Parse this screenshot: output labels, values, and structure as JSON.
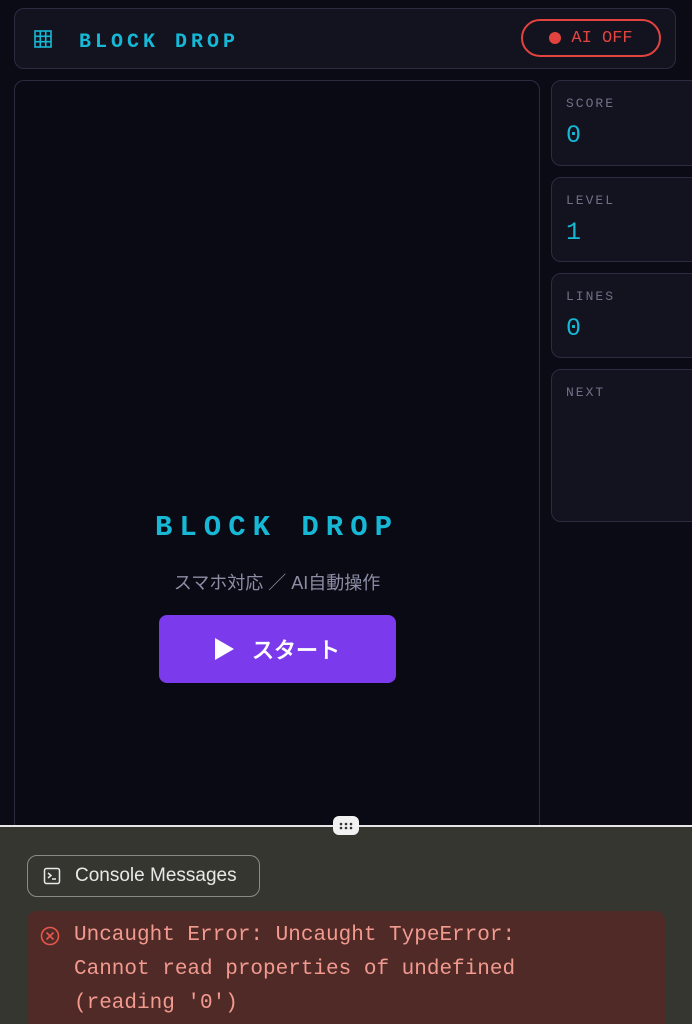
{
  "header": {
    "title": "BLOCK DROP",
    "grid_icon": "grid-icon",
    "ai_toggle_label": "AI OFF",
    "ai_status_color": "#e3433f"
  },
  "board": {
    "overlay_title": "BLOCK DROP",
    "overlay_subtitle": "スマホ対応 ／ AI自動操作",
    "start_label": "スタート",
    "start_color": "#7c3aed"
  },
  "stats": {
    "score_label": "SCORE",
    "score_value": "0",
    "level_label": "LEVEL",
    "level_value": "1",
    "lines_label": "LINES",
    "lines_value": "0",
    "next_label": "NEXT"
  },
  "devtools": {
    "tab_label": "Console Messages",
    "error_message": "Uncaught Error: Uncaught TypeError:\nCannot read properties of undefined\n(reading '0')"
  },
  "colors": {
    "accent": "#16b8d6",
    "background": "#0b0b16",
    "error": "#f29a8f"
  }
}
